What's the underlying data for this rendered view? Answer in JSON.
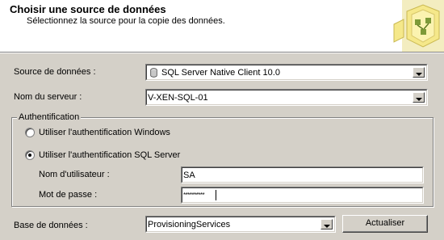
{
  "header": {
    "title": "Choisir une source de données",
    "subtitle": "Sélectionnez la source pour la copie des données."
  },
  "data_source": {
    "label": "Source de données :",
    "value": "SQL Server Native Client 10.0"
  },
  "server": {
    "label": "Nom du serveur :",
    "value": "V-XEN-SQL-01"
  },
  "authentication": {
    "legend": "Authentification",
    "windows_label": "Utiliser l'authentification Windows",
    "sql_label": "Utiliser l'authentification SQL Server",
    "selected": "sql",
    "username_label": "Nom d'utilisateur :",
    "username_value": "SA",
    "password_label": "Mot de passe :",
    "password_value": "**********"
  },
  "database": {
    "label": "Base de données :",
    "value": "ProvisioningServices"
  },
  "refresh_button": {
    "label": "Actualiser"
  },
  "colors": {
    "dialog_bg": "#d4d0c8",
    "header_bg": "#ffffff",
    "art_yellow": "#f5e88a",
    "art_green": "#7d9a38"
  },
  "icons": {
    "data_source_item": "database-icon",
    "header_art": "wizard-connector-graphic"
  }
}
